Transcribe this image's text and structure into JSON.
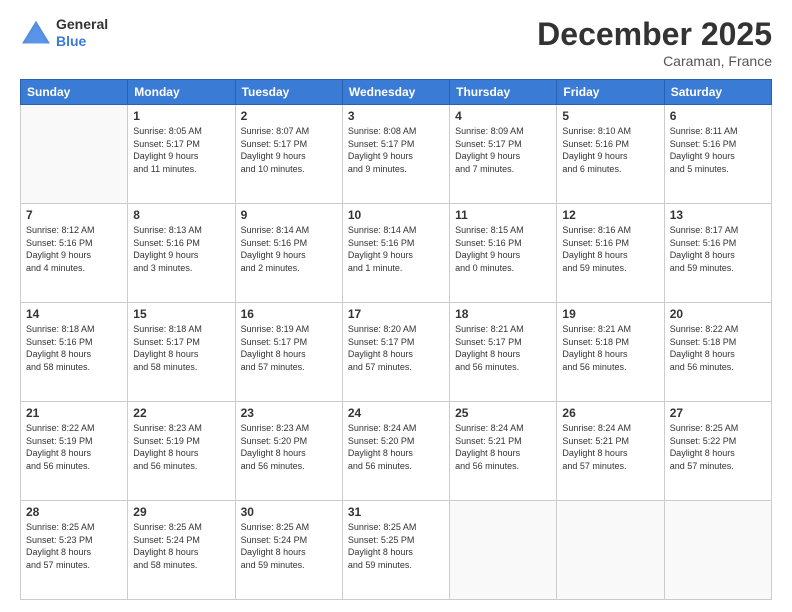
{
  "header": {
    "logo_line1": "General",
    "logo_line2": "Blue",
    "month": "December 2025",
    "location": "Caraman, France"
  },
  "weekdays": [
    "Sunday",
    "Monday",
    "Tuesday",
    "Wednesday",
    "Thursday",
    "Friday",
    "Saturday"
  ],
  "weeks": [
    [
      {
        "day": "",
        "empty": true
      },
      {
        "day": "1",
        "sunrise": "8:05 AM",
        "sunset": "5:17 PM",
        "daylight": "9 hours and 11 minutes."
      },
      {
        "day": "2",
        "sunrise": "8:07 AM",
        "sunset": "5:17 PM",
        "daylight": "9 hours and 10 minutes."
      },
      {
        "day": "3",
        "sunrise": "8:08 AM",
        "sunset": "5:17 PM",
        "daylight": "9 hours and 9 minutes."
      },
      {
        "day": "4",
        "sunrise": "8:09 AM",
        "sunset": "5:17 PM",
        "daylight": "9 hours and 7 minutes."
      },
      {
        "day": "5",
        "sunrise": "8:10 AM",
        "sunset": "5:16 PM",
        "daylight": "9 hours and 6 minutes."
      },
      {
        "day": "6",
        "sunrise": "8:11 AM",
        "sunset": "5:16 PM",
        "daylight": "9 hours and 5 minutes."
      }
    ],
    [
      {
        "day": "7",
        "sunrise": "8:12 AM",
        "sunset": "5:16 PM",
        "daylight": "9 hours and 4 minutes."
      },
      {
        "day": "8",
        "sunrise": "8:13 AM",
        "sunset": "5:16 PM",
        "daylight": "9 hours and 3 minutes."
      },
      {
        "day": "9",
        "sunrise": "8:14 AM",
        "sunset": "5:16 PM",
        "daylight": "9 hours and 2 minutes."
      },
      {
        "day": "10",
        "sunrise": "8:14 AM",
        "sunset": "5:16 PM",
        "daylight": "9 hours and 1 minute."
      },
      {
        "day": "11",
        "sunrise": "8:15 AM",
        "sunset": "5:16 PM",
        "daylight": "9 hours and 0 minutes."
      },
      {
        "day": "12",
        "sunrise": "8:16 AM",
        "sunset": "5:16 PM",
        "daylight": "8 hours and 59 minutes."
      },
      {
        "day": "13",
        "sunrise": "8:17 AM",
        "sunset": "5:16 PM",
        "daylight": "8 hours and 59 minutes."
      }
    ],
    [
      {
        "day": "14",
        "sunrise": "8:18 AM",
        "sunset": "5:16 PM",
        "daylight": "8 hours and 58 minutes."
      },
      {
        "day": "15",
        "sunrise": "8:18 AM",
        "sunset": "5:17 PM",
        "daylight": "8 hours and 58 minutes."
      },
      {
        "day": "16",
        "sunrise": "8:19 AM",
        "sunset": "5:17 PM",
        "daylight": "8 hours and 57 minutes."
      },
      {
        "day": "17",
        "sunrise": "8:20 AM",
        "sunset": "5:17 PM",
        "daylight": "8 hours and 57 minutes."
      },
      {
        "day": "18",
        "sunrise": "8:21 AM",
        "sunset": "5:17 PM",
        "daylight": "8 hours and 56 minutes."
      },
      {
        "day": "19",
        "sunrise": "8:21 AM",
        "sunset": "5:18 PM",
        "daylight": "8 hours and 56 minutes."
      },
      {
        "day": "20",
        "sunrise": "8:22 AM",
        "sunset": "5:18 PM",
        "daylight": "8 hours and 56 minutes."
      }
    ],
    [
      {
        "day": "21",
        "sunrise": "8:22 AM",
        "sunset": "5:19 PM",
        "daylight": "8 hours and 56 minutes."
      },
      {
        "day": "22",
        "sunrise": "8:23 AM",
        "sunset": "5:19 PM",
        "daylight": "8 hours and 56 minutes."
      },
      {
        "day": "23",
        "sunrise": "8:23 AM",
        "sunset": "5:20 PM",
        "daylight": "8 hours and 56 minutes."
      },
      {
        "day": "24",
        "sunrise": "8:24 AM",
        "sunset": "5:20 PM",
        "daylight": "8 hours and 56 minutes."
      },
      {
        "day": "25",
        "sunrise": "8:24 AM",
        "sunset": "5:21 PM",
        "daylight": "8 hours and 56 minutes."
      },
      {
        "day": "26",
        "sunrise": "8:24 AM",
        "sunset": "5:21 PM",
        "daylight": "8 hours and 57 minutes."
      },
      {
        "day": "27",
        "sunrise": "8:25 AM",
        "sunset": "5:22 PM",
        "daylight": "8 hours and 57 minutes."
      }
    ],
    [
      {
        "day": "28",
        "sunrise": "8:25 AM",
        "sunset": "5:23 PM",
        "daylight": "8 hours and 57 minutes."
      },
      {
        "day": "29",
        "sunrise": "8:25 AM",
        "sunset": "5:24 PM",
        "daylight": "8 hours and 58 minutes."
      },
      {
        "day": "30",
        "sunrise": "8:25 AM",
        "sunset": "5:24 PM",
        "daylight": "8 hours and 59 minutes."
      },
      {
        "day": "31",
        "sunrise": "8:25 AM",
        "sunset": "5:25 PM",
        "daylight": "8 hours and 59 minutes."
      },
      {
        "day": "",
        "empty": true
      },
      {
        "day": "",
        "empty": true
      },
      {
        "day": "",
        "empty": true
      }
    ]
  ]
}
